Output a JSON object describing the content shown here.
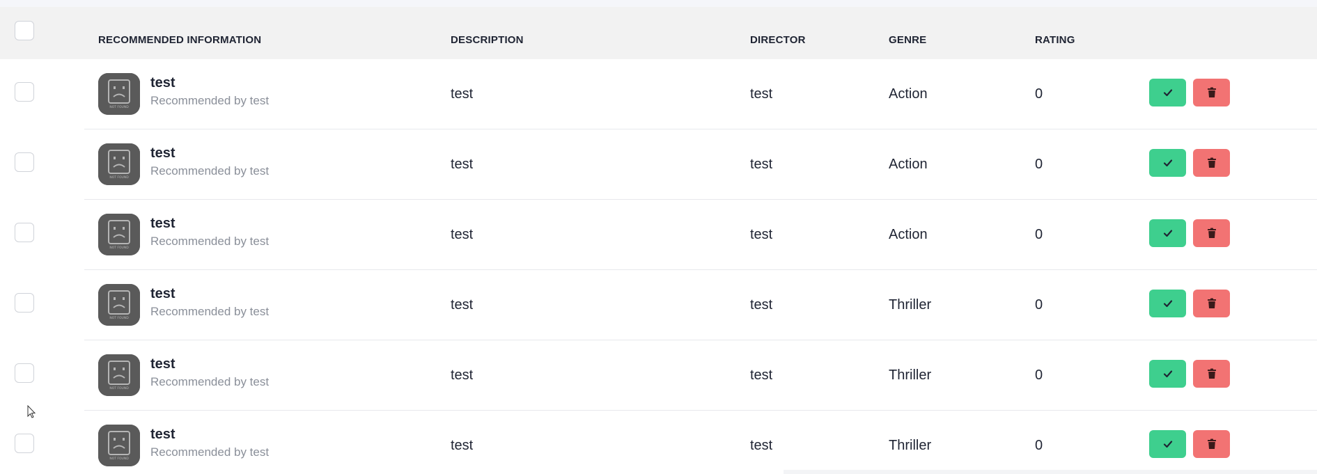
{
  "table": {
    "columns": {
      "info": "RECOMMENDED INFORMATION",
      "description": "DESCRIPTION",
      "director": "DIRECTOR",
      "genre": "GENRE",
      "rating": "RATING"
    },
    "thumbnail_text": "NOT FOUND",
    "rows": [
      {
        "title": "test",
        "subtitle": "Recommended by test",
        "description": "test",
        "director": "test",
        "genre": "Action",
        "rating": "0"
      },
      {
        "title": "test",
        "subtitle": "Recommended by test",
        "description": "test",
        "director": "test",
        "genre": "Action",
        "rating": "0"
      },
      {
        "title": "test",
        "subtitle": "Recommended by test",
        "description": "test",
        "director": "test",
        "genre": "Action",
        "rating": "0"
      },
      {
        "title": "test",
        "subtitle": "Recommended by test",
        "description": "test",
        "director": "test",
        "genre": "Thriller",
        "rating": "0"
      },
      {
        "title": "test",
        "subtitle": "Recommended by test",
        "description": "test",
        "director": "test",
        "genre": "Thriller",
        "rating": "0"
      },
      {
        "title": "test",
        "subtitle": "Recommended by test",
        "description": "test",
        "director": "test",
        "genre": "Thriller",
        "rating": "0"
      }
    ]
  },
  "actions": {
    "approve_icon": "check-icon",
    "delete_icon": "trash-icon"
  },
  "colors": {
    "approve": "#3ecf8e",
    "delete": "#f27373",
    "header_bg": "#f2f2f2",
    "thumbnail_bg": "#5a5a5a"
  }
}
